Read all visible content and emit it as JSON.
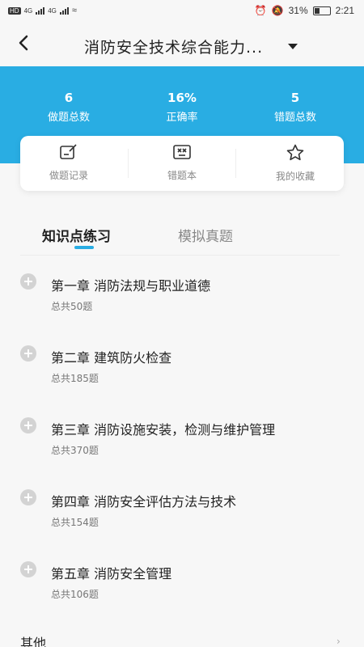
{
  "status_bar": {
    "left_badges": [
      "HD",
      "4G",
      "4G"
    ],
    "battery": "31%",
    "time": "2:21"
  },
  "nav": {
    "back_icon": "chevron-left-icon",
    "title": "消防安全技术综合能力...",
    "dropdown_icon": "caret-down-icon"
  },
  "stats": [
    {
      "value": "6",
      "label": "做题总数"
    },
    {
      "value": "16%",
      "label": "正确率"
    },
    {
      "value": "5",
      "label": "错题总数"
    }
  ],
  "shortcuts": [
    {
      "label": "做题记录",
      "icon": "edit-note-icon"
    },
    {
      "label": "错题本",
      "icon": "wrong-book-icon"
    },
    {
      "label": "我的收藏",
      "icon": "star-icon"
    }
  ],
  "tabs": {
    "active": "知识点练习",
    "inactive": "模拟真题"
  },
  "chapters": [
    {
      "title": "第一章 消防法规与职业道德",
      "count": "总共50题"
    },
    {
      "title": "第二章 建筑防火检查",
      "count": "总共185题"
    },
    {
      "title": "第三章 消防设施安装，检测与维护管理",
      "count": "总共370题"
    },
    {
      "title": "第四章 消防安全评估方法与技术",
      "count": "总共154题"
    },
    {
      "title": "第五章 消防安全管理",
      "count": "总共106题"
    }
  ],
  "other": {
    "label": "其他"
  },
  "colors": {
    "accent": "#29ade3",
    "background": "#f7f7f7"
  }
}
